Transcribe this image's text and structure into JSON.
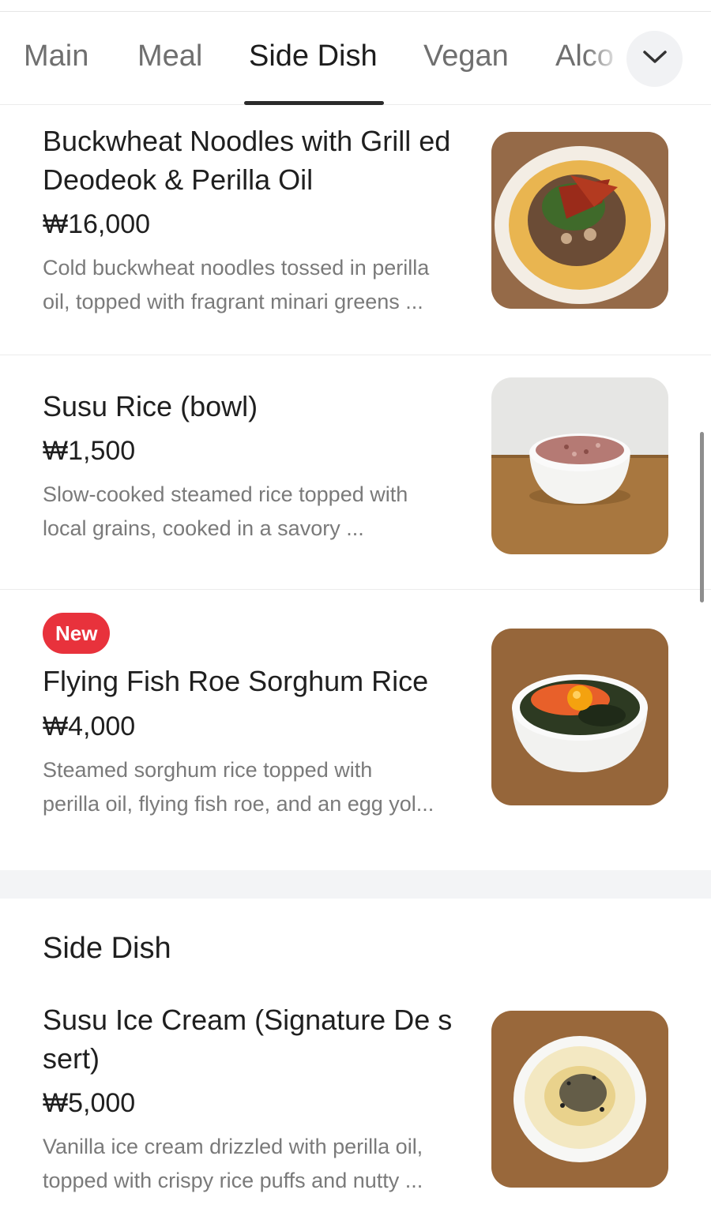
{
  "tabs": [
    {
      "label": "Main"
    },
    {
      "label": "Meal"
    },
    {
      "label": "Side Dish"
    },
    {
      "label": "Vegan"
    },
    {
      "label": "Alco"
    }
  ],
  "active_tab": "Side Dish",
  "icons": {
    "more": "chevron-down-icon"
  },
  "items": [
    {
      "name": "Buckwheat Noodles with Grill ed Deodeok & Perilla Oil",
      "price": "₩16,000",
      "description": "Cold buckwheat noodles tossed in perilla\noil, topped with fragrant minari greens ..."
    },
    {
      "name": "Susu Rice (bowl)",
      "price": "₩1,500",
      "description": "Slow-cooked steamed rice topped with\nlocal grains, cooked in a savory ..."
    },
    {
      "badge": "New",
      "name": "Flying Fish Roe Sorghum Rice",
      "price": "₩4,000",
      "description": "Steamed sorghum rice topped with\nperilla oil, flying fish roe, and an egg yol..."
    }
  ],
  "section": {
    "title": "Side Dish",
    "items": [
      {
        "name": "Susu Ice Cream (Signature De ssert)",
        "price": "₩5,000",
        "description": "Vanilla ice cream drizzled with perilla oil,\ntopped with crispy rice puffs and nutty ..."
      }
    ]
  },
  "colors": {
    "badge": "#e8323c",
    "active_tab_underline": "#2b2b2b",
    "section_gap": "#f3f4f6"
  }
}
